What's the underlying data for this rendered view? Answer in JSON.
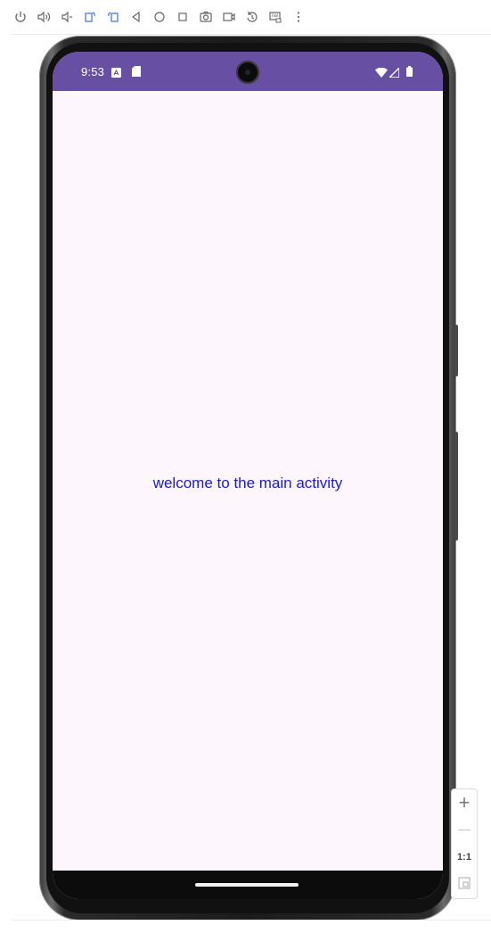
{
  "toolbar": {
    "buttons": [
      {
        "name": "power-icon"
      },
      {
        "name": "volume-up-icon"
      },
      {
        "name": "volume-down-icon"
      },
      {
        "name": "rotate-left-icon"
      },
      {
        "name": "rotate-right-icon"
      },
      {
        "name": "back-icon"
      },
      {
        "name": "home-icon"
      },
      {
        "name": "overview-icon"
      },
      {
        "name": "camera-icon"
      },
      {
        "name": "screen-record-icon"
      },
      {
        "name": "snapshot-icon"
      },
      {
        "name": "keyboard-icon"
      },
      {
        "name": "more-icon"
      }
    ]
  },
  "device": {
    "status_bar": {
      "time": "9:53",
      "color": "#6750a4"
    },
    "app": {
      "message": "welcome to the main activity",
      "message_color": "#1a1ad6",
      "background": "#fdf7fd"
    }
  },
  "zoom": {
    "zoom_in": "+",
    "zoom_out": "—",
    "actual_size": "1:1"
  }
}
